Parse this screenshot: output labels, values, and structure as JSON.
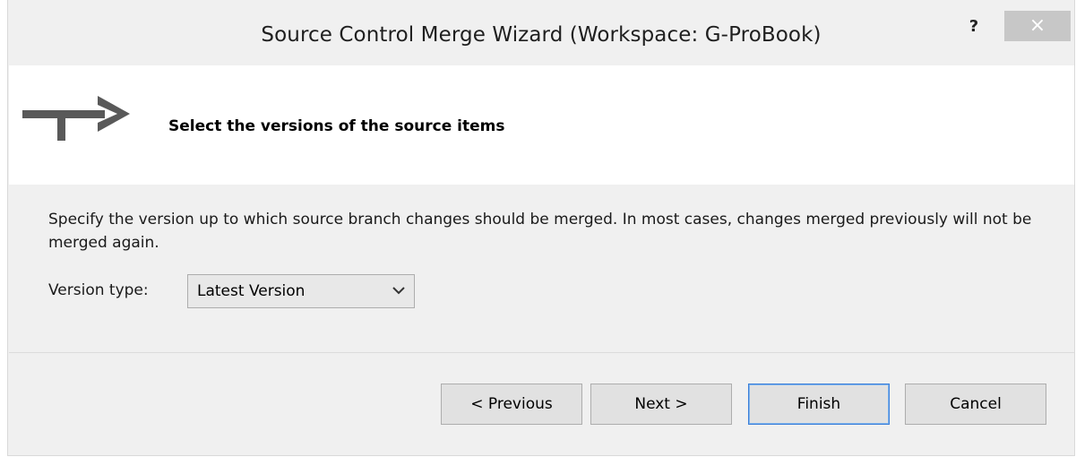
{
  "window": {
    "title": "Source Control Merge Wizard (Workspace: G-ProBook)",
    "help_label": "?",
    "close_label": "×"
  },
  "header": {
    "title": "Select the versions of the source items",
    "icon": "merge-arrow-icon"
  },
  "body": {
    "description": "Specify the version up to which source branch changes should be merged.  In most cases, changes merged previously will not be merged again.",
    "version_type_label": "Version type:",
    "version_type_value": "Latest Version"
  },
  "buttons": {
    "previous": "< Previous",
    "next": "Next >",
    "finish": "Finish",
    "cancel": "Cancel"
  },
  "colors": {
    "close_button_bg": "#c7c7c7",
    "default_button_border": "#3c7fd9",
    "window_bg": "#f0f0f0"
  }
}
